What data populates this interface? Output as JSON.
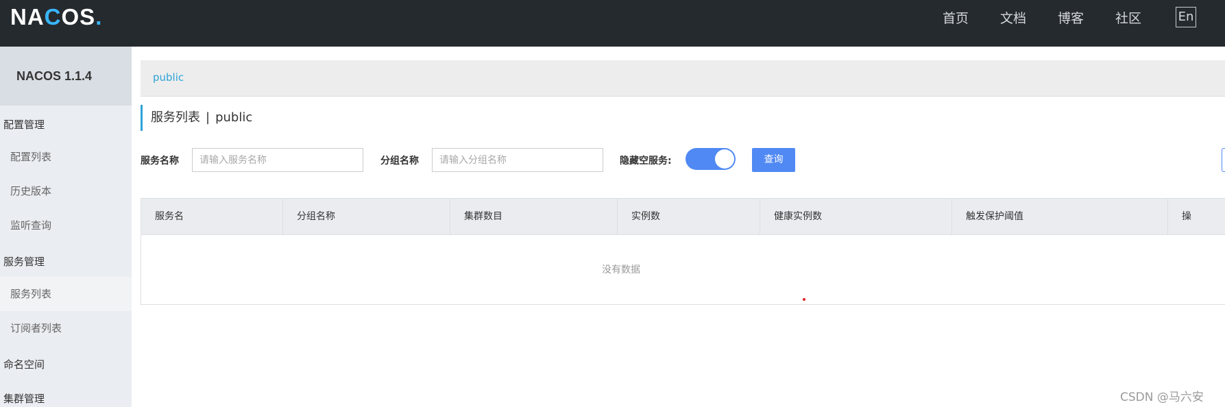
{
  "header": {
    "logo": {
      "part1": "NA",
      "part2": "C",
      "part3": "OS",
      "dot": "."
    },
    "nav": [
      "首页",
      "文档",
      "博客",
      "社区"
    ],
    "lang_button": "En"
  },
  "sidebar": {
    "version": "NACOS 1.1.4",
    "groups": [
      {
        "label": "配置管理",
        "items": [
          "配置列表",
          "历史版本",
          "监听查询"
        ]
      },
      {
        "label": "服务管理",
        "items": [
          "服务列表",
          "订阅者列表"
        ]
      },
      {
        "label": "命名空间",
        "items": []
      },
      {
        "label": "集群管理",
        "items": []
      }
    ],
    "active_item": "服务列表"
  },
  "breadcrumb": {
    "namespace": "public"
  },
  "page": {
    "title": "服务列表",
    "separator": "|",
    "namespace": "public"
  },
  "filters": {
    "service_name_label": "服务名称",
    "service_name_placeholder": "请输入服务名称",
    "group_name_label": "分组名称",
    "group_name_placeholder": "请输入分组名称",
    "hide_empty_label": "隐藏空服务:",
    "hide_empty_on": true,
    "query_button": "查询"
  },
  "table": {
    "columns": [
      "服务名",
      "分组名称",
      "集群数目",
      "实例数",
      "健康实例数",
      "触发保护阈值",
      "操"
    ],
    "rows": [],
    "empty_text": "没有数据"
  },
  "watermark": "CSDN @马六安",
  "colors": {
    "topbar": "#252a2f",
    "accent": "#5089f4",
    "link": "#2ea3d8",
    "sidebar": "#eaedf1"
  }
}
